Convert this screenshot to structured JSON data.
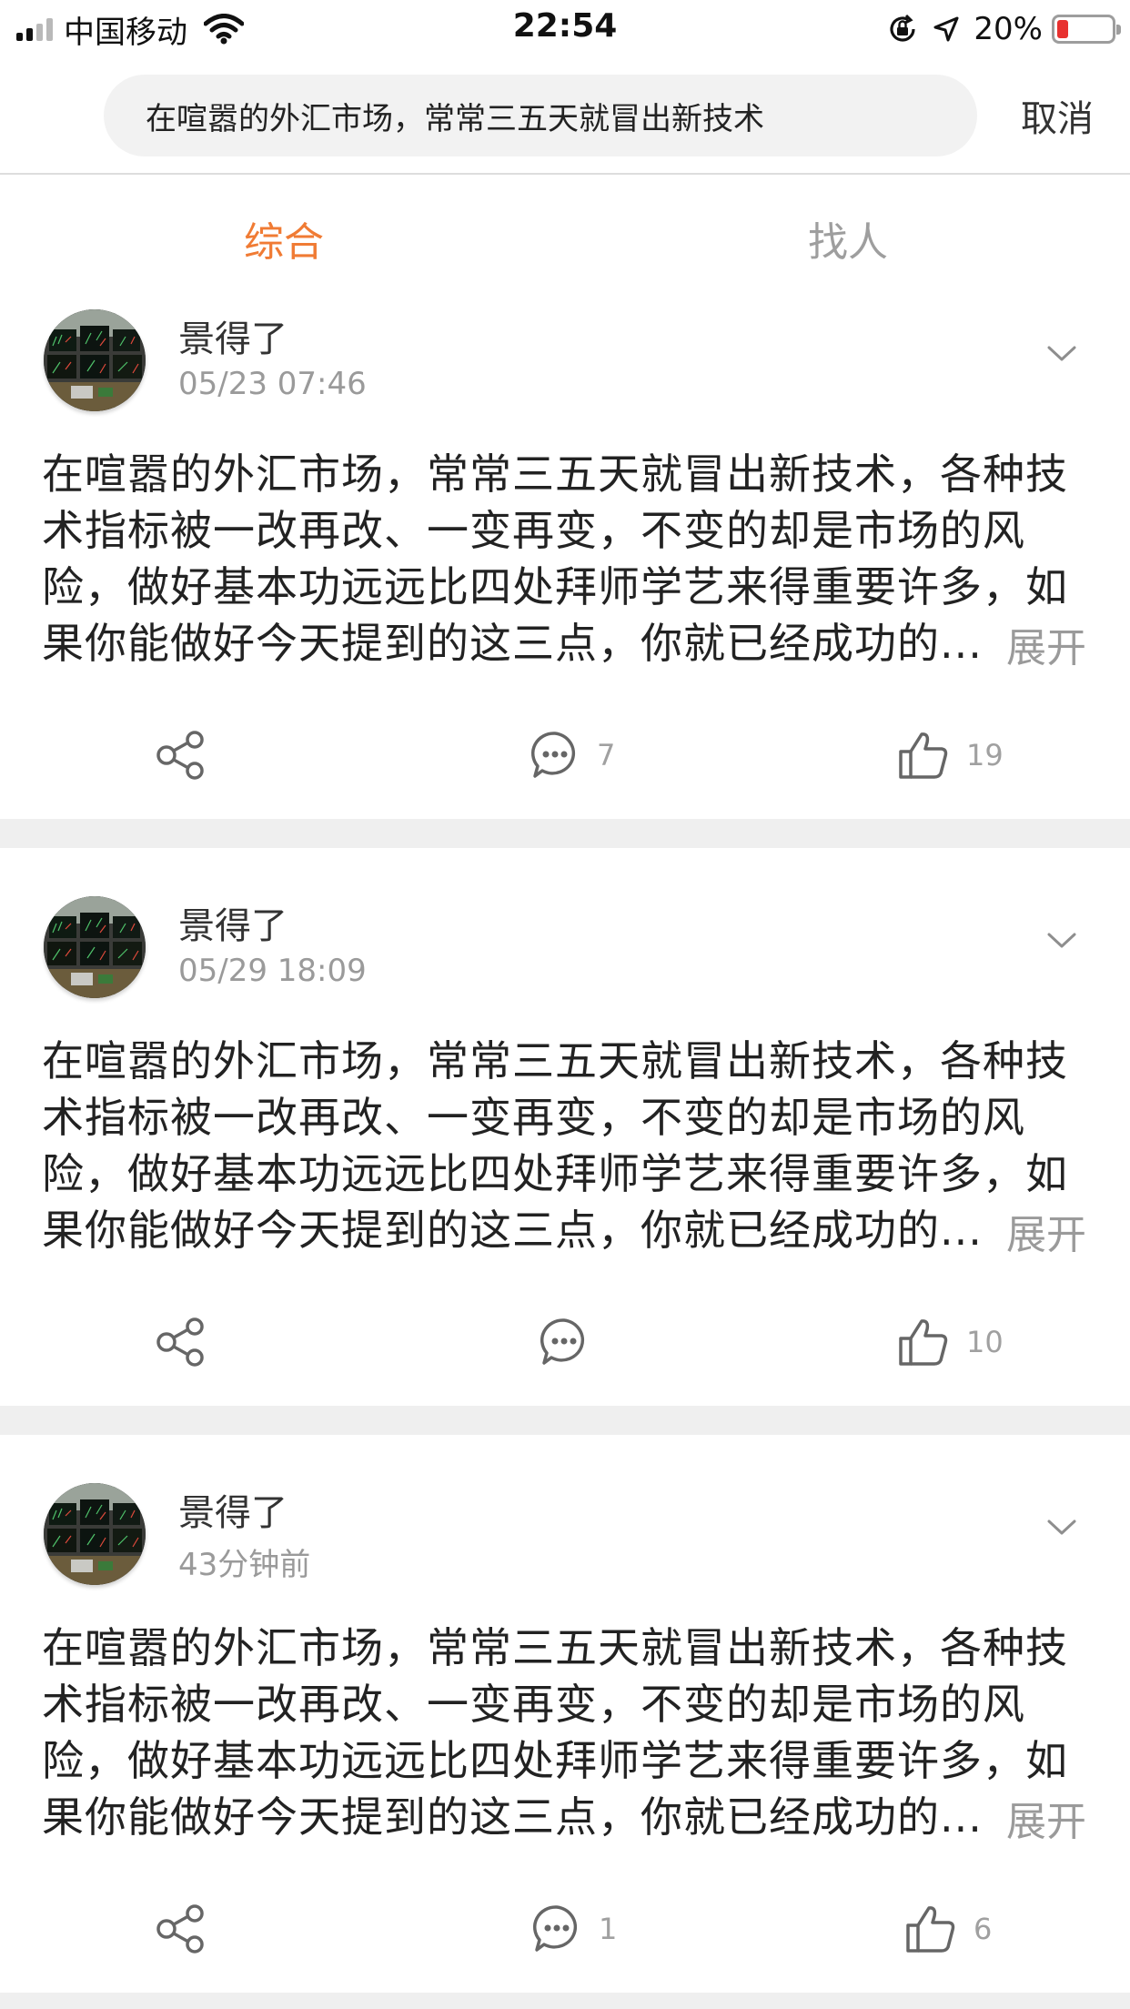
{
  "status_bar": {
    "carrier": "中国移动",
    "time": "22:54",
    "battery_percent": "20%",
    "battery_level": 0.2,
    "battery_color": "#e8312f"
  },
  "search": {
    "query": "在喧嚣的外汇市场，常常三五天就冒出新技术",
    "cancel_label": "取消"
  },
  "tabs": [
    {
      "label": "综合",
      "active": true
    },
    {
      "label": "找人",
      "active": false
    }
  ],
  "accent_color": "#f07b34",
  "posts": [
    {
      "author": "景得了",
      "time": "05/23 07:46",
      "lines": [
        "在喧嚣的外汇市场，常常三五天就冒出新技术，各种技",
        "术指标被一改再改、一变再变，不变的却是市场的风",
        "险，做好基本功远远比四处拜师学艺来得重要许多，如",
        "果你能做好今天提到的这三点，你就已经成功的..."
      ],
      "expand_label": "展开",
      "share_icon": "share-icon",
      "comment_count": "7",
      "like_count": "19"
    },
    {
      "author": "景得了",
      "time": "05/29 18:09",
      "lines": [
        "在喧嚣的外汇市场，常常三五天就冒出新技术，各种技",
        "术指标被一改再改、一变再变，不变的却是市场的风",
        "险，做好基本功远远比四处拜师学艺来得重要许多，如",
        "果你能做好今天提到的这三点，你就已经成功的..."
      ],
      "expand_label": "展开",
      "share_icon": "share-icon",
      "comment_count": "",
      "like_count": "10"
    },
    {
      "author": "景得了",
      "time": "43分钟前",
      "lines": [
        "在喧嚣的外汇市场，常常三五天就冒出新技术，各种技",
        "术指标被一改再改、一变再变，不变的却是市场的风",
        "险，做好基本功远远比四处拜师学艺来得重要许多，如",
        "果你能做好今天提到的这三点，你就已经成功的..."
      ],
      "expand_label": "展开",
      "share_icon": "share-icon",
      "comment_count": "1",
      "like_count": "6"
    }
  ]
}
